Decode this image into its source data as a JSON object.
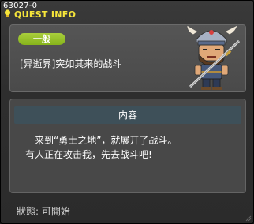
{
  "window": {
    "quest_id": "63027-0",
    "title": "QUEST INFO"
  },
  "quest": {
    "category": "一般",
    "title": "[异逝界]突如其来的战斗",
    "content_header": "内容",
    "description": [
      "一来到“勇士之地”，就展开了战斗。",
      "有人正在攻击我，先去战斗吧!"
    ],
    "status": "狀態:  可開始"
  },
  "colors": {
    "title_yellow": "#f7e63a",
    "badge_green": "#96c12a",
    "content_header_bg": "#3e5059",
    "panel_bg": "#4a4a4a"
  },
  "icons": {
    "title_icon": "quest-lightbulb-icon",
    "npc": "viking-warrior-npc"
  }
}
